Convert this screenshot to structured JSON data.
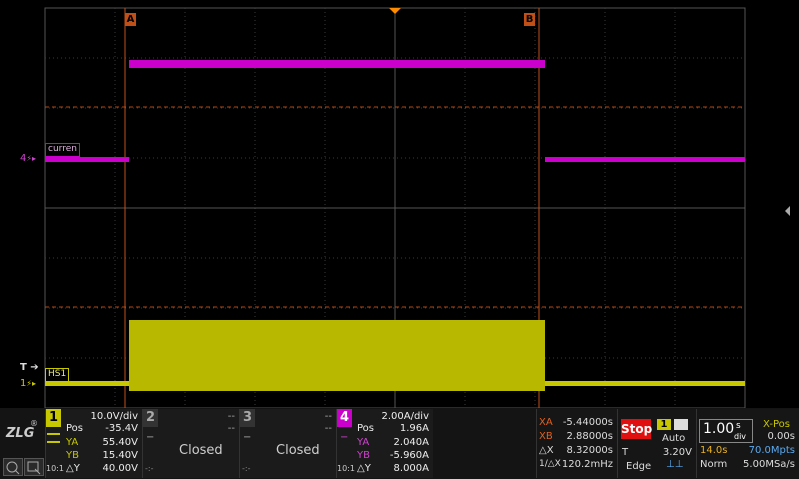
{
  "markers": {
    "a": "A",
    "b": "B"
  },
  "channel_labels": {
    "ch4_tag": "curren",
    "ch1_tag": "HS1",
    "ch4_level": "4",
    "ch1_level": "1",
    "trigger": "T"
  },
  "colors": {
    "ch1": "#c8c800",
    "ch4": "#cc00cc",
    "cursor": "#e06020",
    "grid": "#555555",
    "stop": "#e01010"
  },
  "ch1": {
    "num": "1",
    "scale": "10.0V/div",
    "pos_label": "Pos",
    "pos": "-35.4V",
    "ya_label": "YA",
    "ya": "55.40V",
    "yb_label": "YB",
    "yb": "15.40V",
    "dy_label": "△Y",
    "dy": "40.00V",
    "probe": "10:1"
  },
  "ch2": {
    "num": "2",
    "dash1": "--",
    "dash2": "--",
    "minus": "−",
    "state": "Closed",
    "dots": "-:-"
  },
  "ch3": {
    "num": "3",
    "dash1": "--",
    "dash2": "--",
    "minus": "−",
    "state": "Closed",
    "dots": "-:-"
  },
  "ch4": {
    "num": "4",
    "scale": "2.00A/div",
    "pos_label": "Pos",
    "pos": "1.96A",
    "ya_label": "YA",
    "ya": "2.040A",
    "yb_label": "YB",
    "yb": "-5.960A",
    "dy_label": "△Y",
    "dy": "8.000A",
    "probe": "10:1"
  },
  "cursor": {
    "xa_label": "XA",
    "xa": "-5.44000s",
    "xb_label": "XB",
    "xb": "2.88000s",
    "dx_label": "△X",
    "dx": "8.32000s",
    "inv_label": "1/△X",
    "inv": "120.2mHz"
  },
  "trigger": {
    "run_state": "Stop",
    "source": "1",
    "mode": "Auto",
    "t_label": "T",
    "level": "3.20V",
    "type": "Edge"
  },
  "timebase": {
    "scale_num": "1.00",
    "scale_unit_top": "s",
    "scale_unit_bottom": "div",
    "xpos_label": "X-Pos",
    "xpos": "0.00s",
    "record": "14.0s",
    "points": "70.0Mpts",
    "acq": "Norm",
    "rate": "5.00MSa/s"
  },
  "logo": "ZLG"
}
